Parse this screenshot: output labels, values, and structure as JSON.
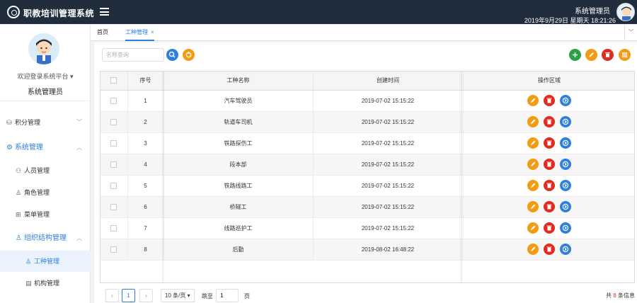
{
  "header": {
    "app_title": "职教培训管理系统",
    "user_name": "系统管理员",
    "datetime": "2019年9月29日 星期天 18:21:26"
  },
  "sidebar": {
    "welcome": "欢迎登录系统平台",
    "admin_name": "系统管理员",
    "items": [
      {
        "label": "积分管理",
        "icon": "database-icon",
        "arrow": "﹀"
      },
      {
        "label": "系统管理",
        "icon": "gear-icon",
        "arrow": "︿"
      },
      {
        "label": "人员管理",
        "icon": "users-icon"
      },
      {
        "label": "角色管理",
        "icon": "user-icon"
      },
      {
        "label": "菜单管理",
        "icon": "grid-icon"
      },
      {
        "label": "组织结构管理",
        "icon": "org-icon",
        "arrow": "︿"
      },
      {
        "label": "工种管理",
        "icon": "worker-icon"
      },
      {
        "label": "机构管理",
        "icon": "building-icon"
      }
    ]
  },
  "tabs": [
    {
      "label": "首页"
    },
    {
      "label": "工种管理",
      "close": "×"
    }
  ],
  "search": {
    "placeholder": "名称查询"
  },
  "table": {
    "headers": [
      "序号",
      "工种名称",
      "创建时间",
      "操作区域"
    ],
    "rows": [
      {
        "no": "1",
        "name": "汽车驾驶员",
        "created": "2019-07-02 15:15:22"
      },
      {
        "no": "2",
        "name": "轨道车司机",
        "created": "2019-07-02 15:15:22"
      },
      {
        "no": "3",
        "name": "铁路探伤工",
        "created": "2019-07-02 15:15:22"
      },
      {
        "no": "4",
        "name": "段本部",
        "created": "2019-07-02 15:15:22"
      },
      {
        "no": "5",
        "name": "铁路线路工",
        "created": "2019-07-02 15:15:22"
      },
      {
        "no": "6",
        "name": "桥隧工",
        "created": "2019-07-02 15:15:22"
      },
      {
        "no": "7",
        "name": "线路巡护工",
        "created": "2019-07-02 15:15:22"
      },
      {
        "no": "8",
        "name": "后勤",
        "created": "2019-08-02 16:48:22"
      }
    ]
  },
  "pager": {
    "prev": "‹",
    "current": "1",
    "next": "›",
    "page_size": "10 条/页",
    "jump_label": "跳至",
    "jump_value": "1",
    "page_unit": "页",
    "total_prefix": "共 ",
    "total_count": "8",
    "total_suffix": " 条信息"
  },
  "colors": {
    "accent": "#2d7fe0",
    "header_bg": "#1f2d3d",
    "edit": "#f39c12",
    "delete": "#e02b20",
    "add": "#2ba046"
  }
}
